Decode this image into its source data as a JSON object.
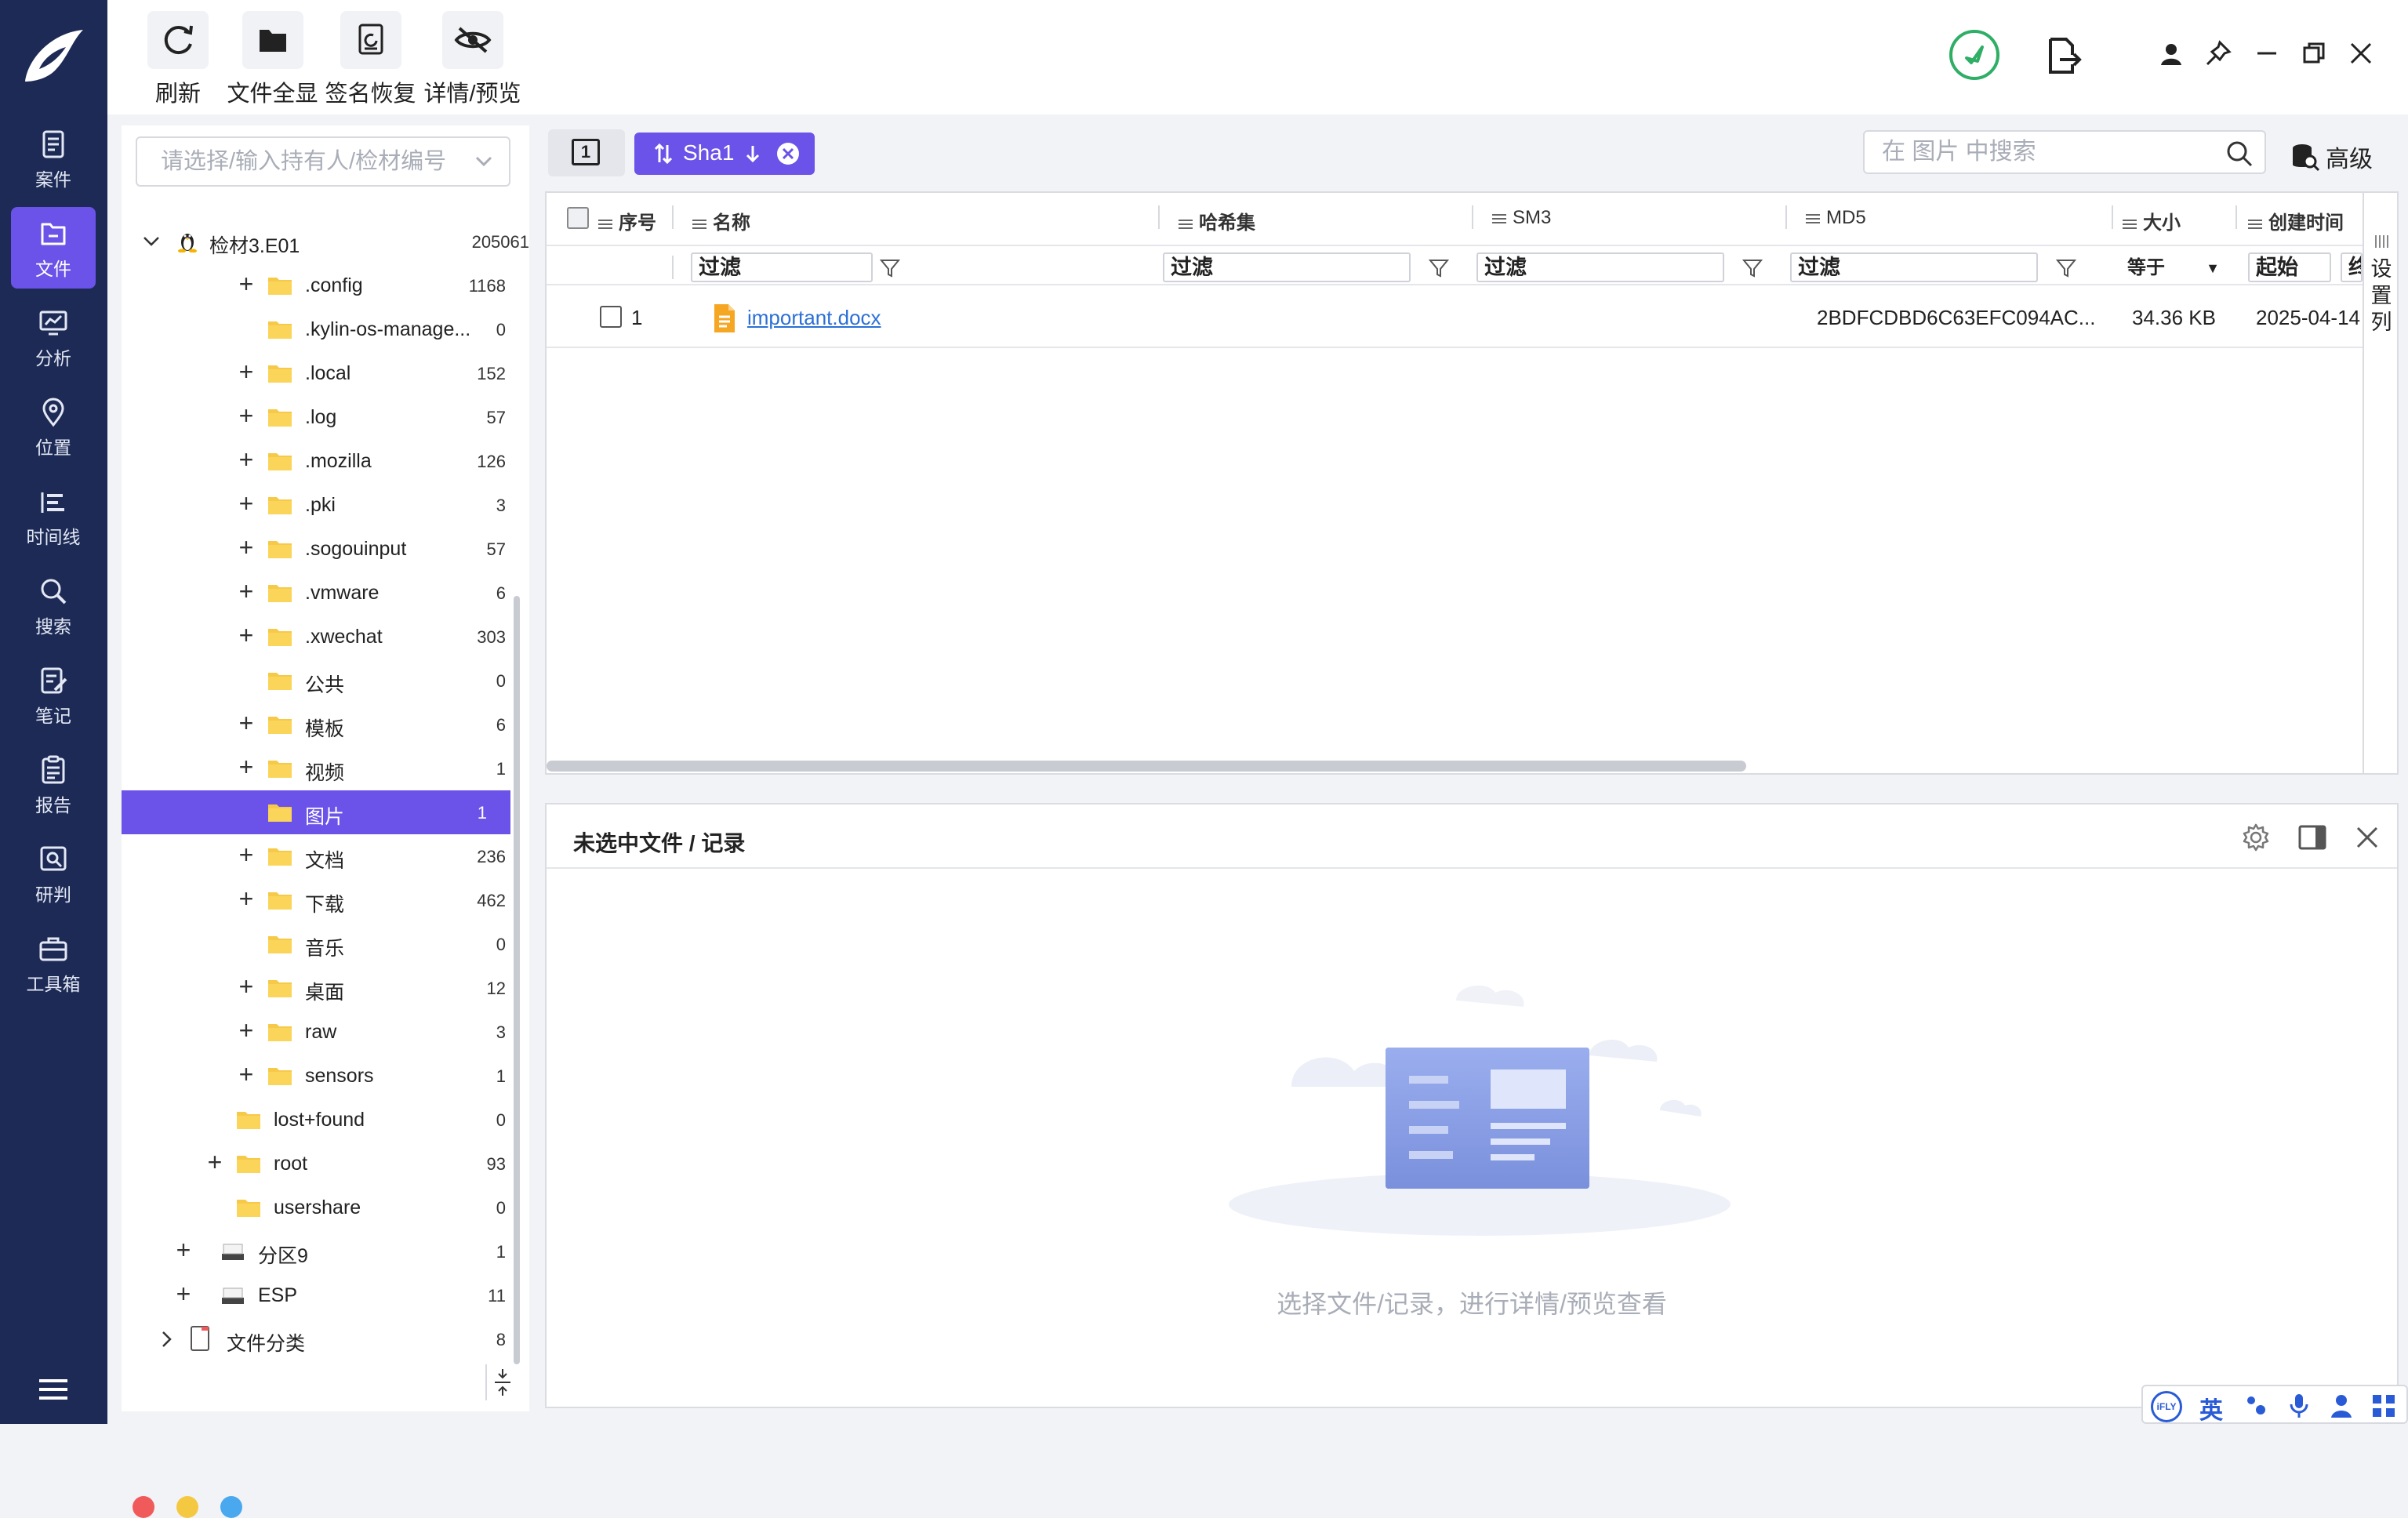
{
  "nav": {
    "items": [
      {
        "label": "案件",
        "icon": "case-icon"
      },
      {
        "label": "文件",
        "icon": "file-icon",
        "active": true
      },
      {
        "label": "分析",
        "icon": "analysis-icon"
      },
      {
        "label": "位置",
        "icon": "location-pin-icon"
      },
      {
        "label": "时间线",
        "icon": "timeline-icon"
      },
      {
        "label": "搜索",
        "icon": "search-icon"
      },
      {
        "label": "笔记",
        "icon": "note-icon"
      },
      {
        "label": "报告",
        "icon": "report-icon"
      },
      {
        "label": "研判",
        "icon": "judgement-icon"
      },
      {
        "label": "工具箱",
        "icon": "toolbox-icon"
      }
    ]
  },
  "toolbar": {
    "refresh": "刷新",
    "show_all_files": "文件全显",
    "signature_recovery": "签名恢复",
    "detail_preview": "详情/预览"
  },
  "tree": {
    "selector_placeholder": "请选择/输入持有人/检材编号",
    "root": {
      "name": "检材3.E01",
      "count": "205061"
    },
    "rows": [
      {
        "name": ".config",
        "count": "1168",
        "expandable": true
      },
      {
        "name": ".kylin-os-manage...",
        "count": "0",
        "expandable": false
      },
      {
        "name": ".local",
        "count": "152",
        "expandable": true
      },
      {
        "name": ".log",
        "count": "57",
        "expandable": true
      },
      {
        "name": ".mozilla",
        "count": "126",
        "expandable": true
      },
      {
        "name": ".pki",
        "count": "3",
        "expandable": true
      },
      {
        "name": ".sogouinput",
        "count": "57",
        "expandable": true
      },
      {
        "name": ".vmware",
        "count": "6",
        "expandable": true
      },
      {
        "name": ".xwechat",
        "count": "303",
        "expandable": true
      },
      {
        "name": "公共",
        "count": "0",
        "expandable": false
      },
      {
        "name": "模板",
        "count": "6",
        "expandable": true
      },
      {
        "name": "视频",
        "count": "1",
        "expandable": true
      },
      {
        "name": "图片",
        "count": "1",
        "expandable": false,
        "selected": true
      },
      {
        "name": "文档",
        "count": "236",
        "expandable": true
      },
      {
        "name": "下载",
        "count": "462",
        "expandable": true
      },
      {
        "name": "音乐",
        "count": "0",
        "expandable": false
      },
      {
        "name": "桌面",
        "count": "12",
        "expandable": true
      },
      {
        "name": "raw",
        "count": "3",
        "expandable": true
      },
      {
        "name": "sensors",
        "count": "1",
        "expandable": true
      }
    ],
    "level2": [
      {
        "name": "lost+found",
        "count": "0",
        "expandable": false
      },
      {
        "name": "root",
        "count": "93",
        "expandable": true
      },
      {
        "name": "usershare",
        "count": "0",
        "expandable": false
      }
    ],
    "partitions": [
      {
        "name": "分区9",
        "count": "1"
      },
      {
        "name": "ESP",
        "count": "11"
      }
    ],
    "file_category": {
      "name": "文件分类",
      "count": "8"
    },
    "dots": [
      "#f05a5a",
      "#f5c842",
      "#4aa8ef"
    ]
  },
  "main": {
    "tab_number": "1",
    "sort_chip": "Sha1",
    "search_placeholder": "在 图片 中搜索",
    "advanced": "高级",
    "columns": {
      "seq": "序号",
      "name": "名称",
      "hashset": "哈希集",
      "sm3": "SM3",
      "md5": "MD5",
      "size": "大小",
      "created": "创建时间"
    },
    "filter_placeholder": "过滤",
    "size_op": "等于",
    "date_start": "起始",
    "date_end_partial": "终",
    "column_settings": "设置列",
    "rows": [
      {
        "seq": "1",
        "name": "important.docx",
        "md5": "2BDFCDBD6C63EFC094AC...",
        "size": "34.36 KB",
        "created": "2025-04-14"
      }
    ]
  },
  "detail": {
    "title": "未选中文件 / 记录",
    "empty_text": "选择文件/记录，进行详情/预览查看"
  },
  "ime": {
    "brand": "iFLY",
    "lang": "英"
  },
  "colors": {
    "nav_bg": "#1c2a55",
    "accent": "#6b52e8",
    "link": "#2b6fd6",
    "status_green": "#2fae66"
  }
}
